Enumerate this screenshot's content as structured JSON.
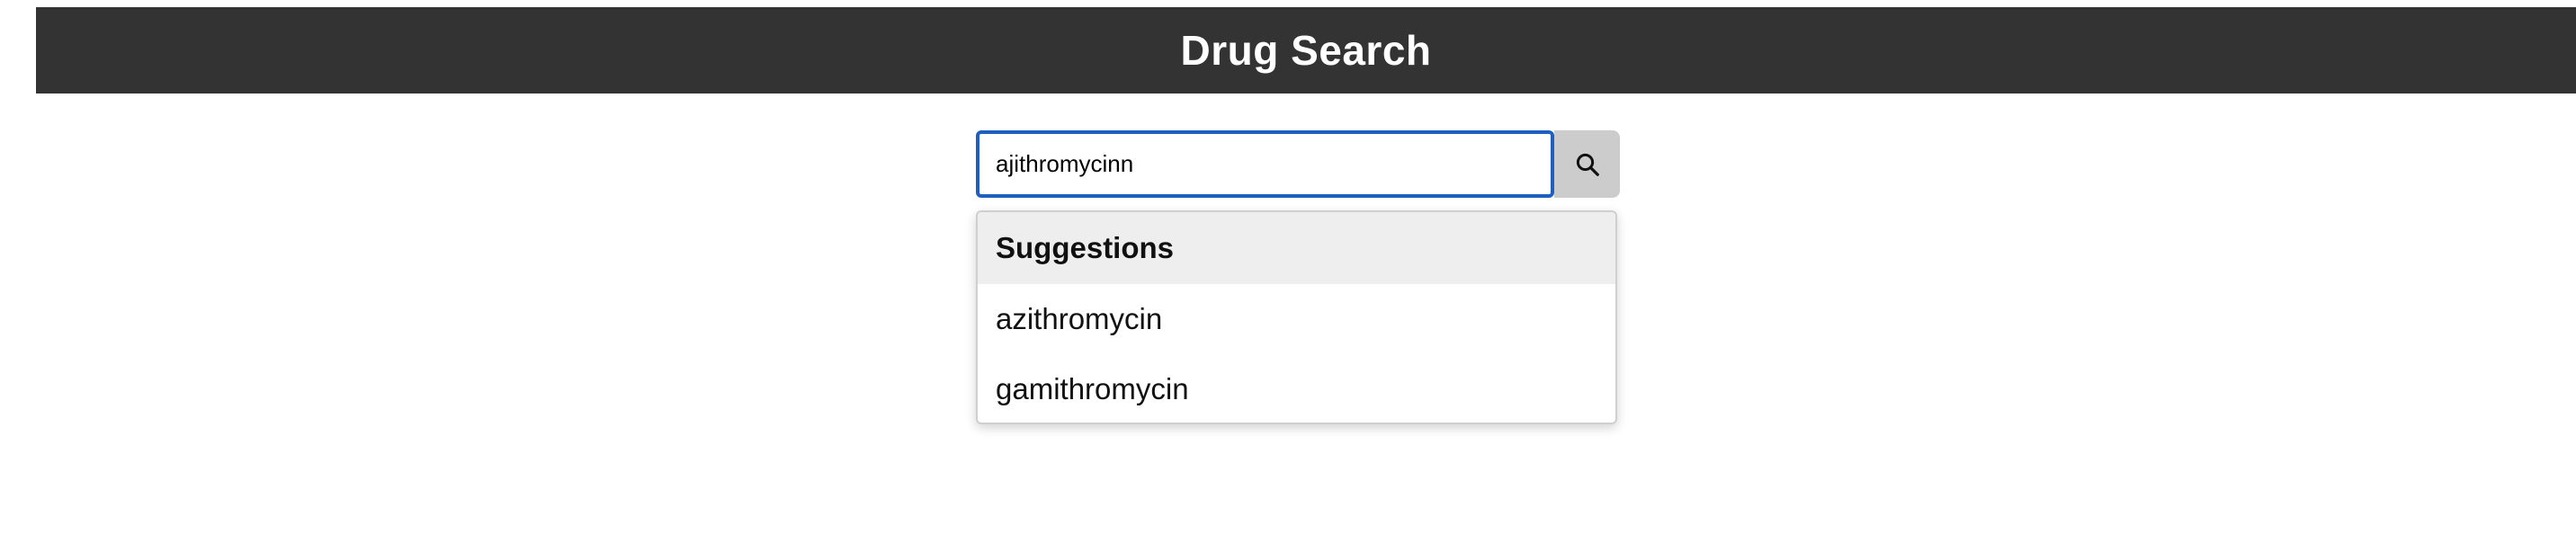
{
  "header": {
    "title": "Drug Search"
  },
  "search": {
    "value": "ajithromycinn",
    "button_icon": "search-icon"
  },
  "suggestions": {
    "heading": "Suggestions",
    "items": [
      {
        "label": "azithromycin"
      },
      {
        "label": "gamithromycin"
      }
    ]
  },
  "colors": {
    "header_bg": "#333333",
    "input_border": "#1f5fbf",
    "button_bg": "#cccccc",
    "suggestions_header_bg": "#eeeeee"
  }
}
